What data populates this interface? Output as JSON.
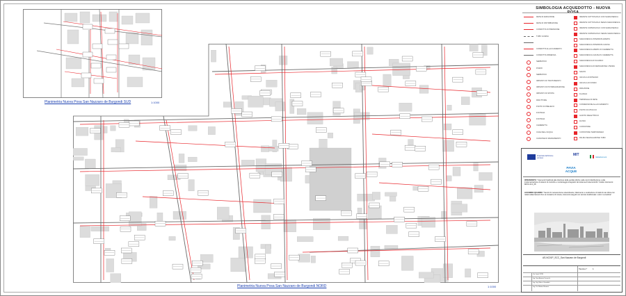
{
  "legend": {
    "title": "SIMBOLOGIA ACQUEDOTTO - NUOVA POSA",
    "left_items": [
      "RETE DI ADDUZIONE",
      "RETE DI DISTRIBUZIONE",
      "CONDOTTA IN PRESSIONE",
      "TUBO GUAINA",
      "",
      "CONDOTTA ALLACCIAMENTO",
      "CONDOTTA DISMESSA",
      "SERBATOIO",
      "POZZO",
      "SERBATOIO",
      "IMPIANTO DI TRATTAMENTO",
      "IMPIANTO DI POTABILIZZAZIONE",
      "IMPIANTO DI SPINTA",
      "RIDUTTORE",
      "PUNTO DI PRELIEVO",
      "FONTANA",
      "FONTANA",
      "CAMERETTA",
      "CASA DELL'ACQUA",
      "CASSONE DI MANDAMENTO"
    ],
    "right_items": [
      "IDRANTE SOTTOSUOLO CON SARACINESCA",
      "IDRANTE SOTTOSUOLO SENZA SARACINESCA",
      "IDRANTE SOPRASUOLO CON SARACINESCA",
      "IDRANTE SOPRASUOLO SENZA SARACINESCA",
      "SARACINESCA INTERRATA APERTA",
      "SARACINESCA INTERRATA CHIUSA",
      "SARACINESCA APERTA IN CAMERETTA",
      "SARACINESCA CHIUSA IN CAMERETTA",
      "SARACINESCA DI SCARICO",
      "SARACINESCA DI DERIVAZIONE UTENZA",
      "SFIATO",
      "VALVOLA DI RITEGNO",
      "VALVOLA DI FONDO",
      "RIDUZIONE",
      "FLANGIA",
      "TERMINALE DI RETE",
      "CONNESSIONE ALLACCIAMENTO",
      "PUNTO DI ATTACCO",
      "GIUNTO DIELETTRICO",
      "FILTRO",
      "CONTATORE",
      "CONTATORE TEMPORANEO",
      "PALINA SEGNALAZIONE TUBO"
    ]
  },
  "captions": {
    "south_plan": "Planimetria Nuova Posa San Nazzaro de Burgondi SUD",
    "south_scale": "1:1000",
    "north_plan": "Planimetria Nuova Posa San Nazzaro de Burgondi NORD",
    "north_scale": "1:1000"
  },
  "titleblock": {
    "logo_labels": [
      "Finanziato dall'Unione europea",
      "MIT",
      "Italiadomani",
      "PAVIA ACQUE"
    ],
    "intervention_label": "INTERVENTO:",
    "intervention_text": "\"Interventi finalizzati alla riduzione delle perdite idriche nelle reti di distribuzione e alla implementazione di sistemi di controllo e monitoraggio integrativi del sistema di telecontrollo\" Codice intervento: M2C4-I4.2_08",
    "agreement_label": "ACCORDO QUADRO:",
    "agreement_text": "\"Servizi di manutenzione straordinaria, rifacimento e sostituzione di tratti di rete idrica con relativi allacciamenti fino al contatore di misura, interventi eseguiti con tecnica tradizionale. Lotto 1 Lomellina\"",
    "project_code": "AS-NC01P_SCC_San Nazzaro de Burgondi",
    "table_label": "Tavola n°",
    "table_value": "1",
    "rows": [
      "Via Verdi 37/39",
      "Ing. Sig. Antonio Scrocchi",
      "Ing. Sig. Marco Grandotti",
      "Ing. Dir. Matteo Romani"
    ]
  },
  "colors": {
    "pipe": "#e8242a",
    "road": "#555555",
    "building": "#dcdcdc",
    "caption": "#1a3fb0"
  }
}
